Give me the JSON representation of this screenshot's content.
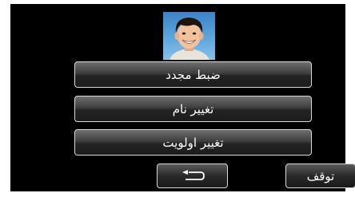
{
  "avatar": {
    "icon": "child-face-portrait"
  },
  "menu": {
    "items": [
      {
        "label": "ضبط مجدد"
      },
      {
        "label": "تغییر نام"
      },
      {
        "label": "تغییر اولویت"
      }
    ]
  },
  "footer": {
    "back_icon": "return-arrow-icon",
    "stop_label": "توقف"
  },
  "colors": {
    "screen_background": "#000000",
    "button_border": "#d9d9d9",
    "text": "#ffffff"
  }
}
